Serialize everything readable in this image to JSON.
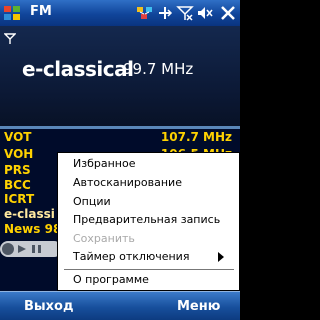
{
  "titlebar": {
    "title": "FM",
    "icons": [
      "windows-start-icon",
      "network-icon",
      "signal-off-icon",
      "volume-mute-icon",
      "close-icon"
    ]
  },
  "now_playing": {
    "station": "e-classical",
    "frequency": "99.7 MHz"
  },
  "stations": [
    {
      "name": "VOT",
      "freq": "107.7 MHz"
    },
    {
      "name": "VOH",
      "freq": "106.5 MHz"
    },
    {
      "name": "PRS",
      "freq": ""
    },
    {
      "name": "BCC",
      "freq": ""
    },
    {
      "name": "ICRT",
      "freq": ""
    },
    {
      "name": "e-classi",
      "freq": ""
    },
    {
      "name": "News 98",
      "freq": ""
    }
  ],
  "menu": {
    "items": [
      {
        "label": "Избранное"
      },
      {
        "label": "Автосканирование"
      },
      {
        "label": "Опции"
      },
      {
        "label": "Предварительная запись"
      },
      {
        "label": "Сохранить"
      },
      {
        "label": "Таймер отключения"
      },
      {
        "label": "О программе"
      }
    ]
  },
  "softkeys": {
    "left": "Выход",
    "right": "Меню"
  },
  "colors": {
    "list_text": "#ffd200",
    "title_bar": "#1a54a8",
    "panel_bg": "#0b1834"
  }
}
